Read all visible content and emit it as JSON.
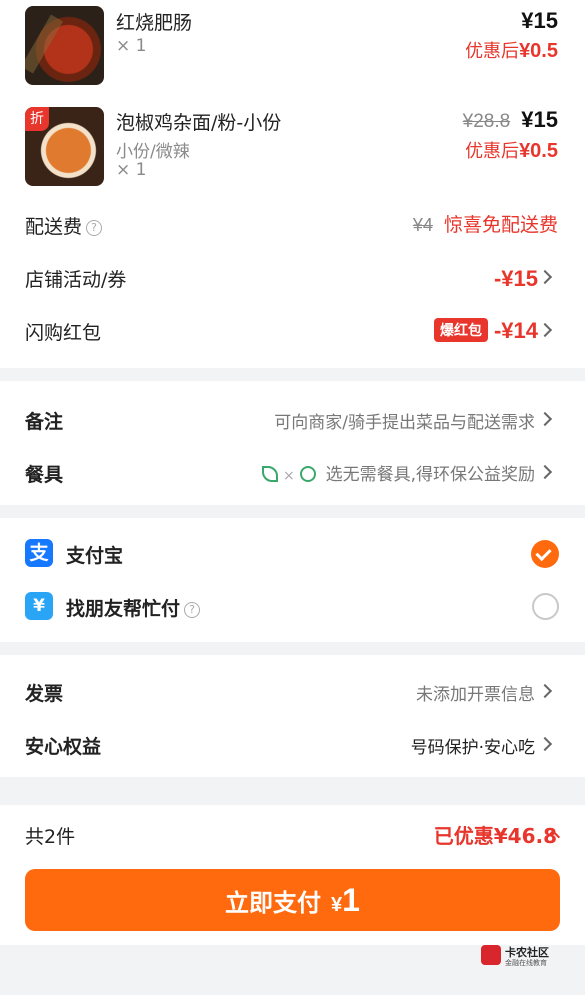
{
  "items": [
    {
      "name": "红烧肥肠",
      "qty": "× 1",
      "price": "¥15",
      "discount_label": "优惠后",
      "discount_price": "¥0.5"
    },
    {
      "name": "泡椒鸡杂面/粉-小份",
      "spec": "小份/微辣",
      "qty": "× 1",
      "original_price": "¥28.8",
      "price": "¥15",
      "discount_label": "优惠后",
      "discount_price": "¥0.5",
      "tag": "折"
    }
  ],
  "delivery": {
    "label": "配送费",
    "original": "¥4",
    "promo": "惊喜免配送费"
  },
  "shop_promo": {
    "label": "店铺活动/券",
    "value": "-¥15"
  },
  "flash_redpack": {
    "label": "闪购红包",
    "badge": "爆红包",
    "value": "-¥14"
  },
  "notes": {
    "label": "备注",
    "value": "可向商家/骑手提出菜品与配送需求"
  },
  "tableware": {
    "label": "餐具",
    "x_mark": "×",
    "value": "选无需餐具,得环保公益奖励"
  },
  "payment": {
    "alipay": {
      "label": "支付宝",
      "icon": "alipay-icon",
      "selected": true
    },
    "friend": {
      "label": "找朋友帮忙付",
      "icon": "friend-pay-icon",
      "selected": false
    }
  },
  "invoice": {
    "label": "发票",
    "value": "未添加开票信息"
  },
  "assurance": {
    "label": "安心权益",
    "value": "号码保护·安心吃"
  },
  "footer": {
    "count": "共2件",
    "saved": "已优惠¥46.8",
    "pay_label": "立即支付",
    "currency": "¥",
    "pay_amount": "1"
  },
  "watermark": {
    "title": "卡农社区",
    "subtitle": "金融在线教育"
  },
  "colors": {
    "accent": "#ff6a0f",
    "red": "#e8362c",
    "alipay_blue": "#1677ff"
  }
}
